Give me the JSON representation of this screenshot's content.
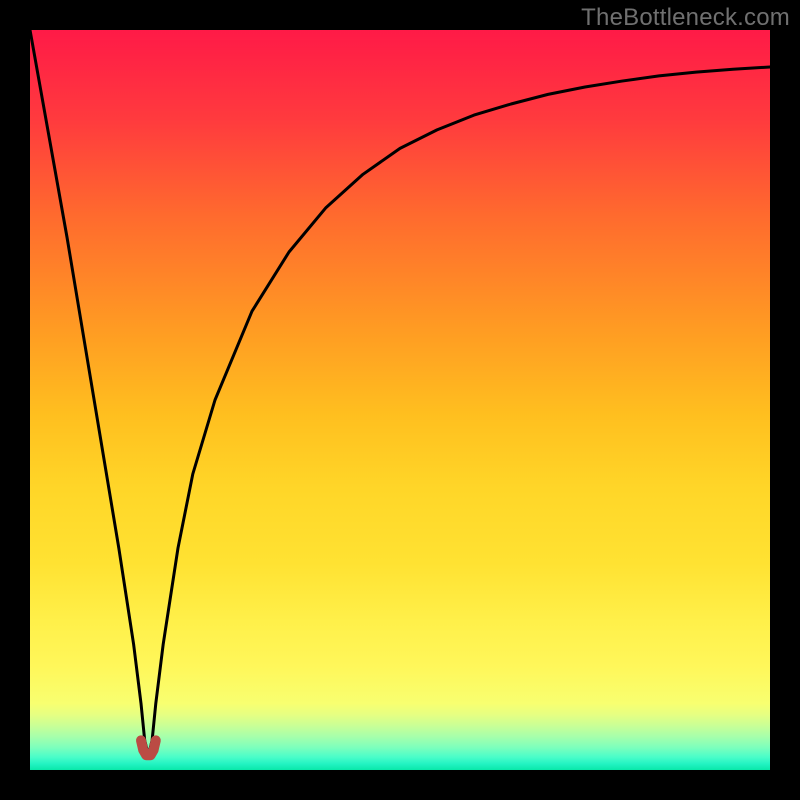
{
  "watermark": "TheBottleneck.com",
  "chart_data": {
    "type": "line",
    "title": "",
    "xlabel": "",
    "ylabel": "",
    "xlim": [
      0,
      100
    ],
    "ylim": [
      0,
      100
    ],
    "series": [
      {
        "name": "curve",
        "style": "black-thin",
        "x": [
          0,
          5,
          10,
          12,
          14,
          15,
          15.5,
          16,
          16.5,
          17,
          18,
          20,
          22,
          25,
          30,
          35,
          40,
          45,
          50,
          55,
          60,
          65,
          70,
          75,
          80,
          85,
          90,
          95,
          100
        ],
        "values": [
          100,
          72,
          42,
          30,
          17,
          9,
          4,
          2,
          4,
          9,
          17,
          30,
          40,
          50,
          62,
          70,
          76,
          80.5,
          84,
          86.5,
          88.5,
          90,
          91.3,
          92.3,
          93.1,
          93.8,
          94.3,
          94.7,
          95
        ]
      },
      {
        "name": "trough-marker",
        "style": "red-thick",
        "x": [
          15,
          15.3,
          15.7,
          16,
          16.3,
          16.7,
          17
        ],
        "values": [
          4,
          2.7,
          2,
          2,
          2,
          2.7,
          4
        ]
      }
    ],
    "background_gradient": {
      "top_color": "#ff1a47",
      "mid_colors": [
        "#ff6a2e",
        "#ffbf1f",
        "#ffe232",
        "#fff75a",
        "#f4ff77"
      ],
      "bottom_band_start": 0.92,
      "bottom_bands": [
        "#d9ff8c",
        "#baffa0",
        "#95ffb3",
        "#6bffc3",
        "#3bfccd",
        "#1cf5c4",
        "#09e8a9"
      ]
    }
  }
}
